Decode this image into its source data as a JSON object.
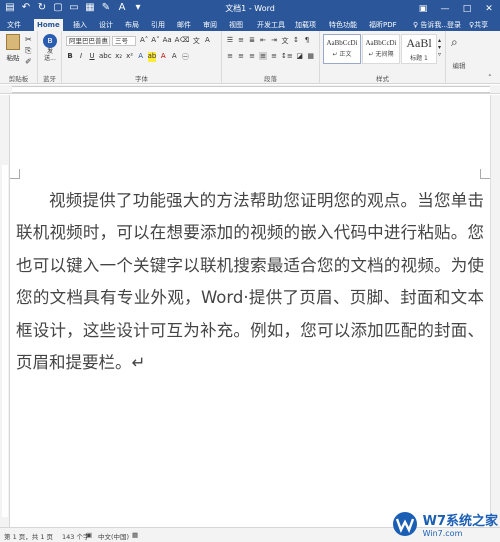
{
  "window": {
    "title": "文档1 - Word"
  },
  "tabs": [
    "文件",
    "Home",
    "插入",
    "设计",
    "布局",
    "引用",
    "邮件",
    "审阅",
    "视图",
    "开发工具",
    "加载项",
    "特色功能",
    "福昕PDF"
  ],
  "tell_me": "♀ 告诉我...",
  "signin": "登录",
  "share": "♀共享",
  "ribbon": {
    "clipboard": {
      "label": "剪贴板",
      "paste": "粘贴"
    },
    "bluetooth": {
      "label": "蓝牙",
      "send": "发\n送..."
    },
    "font": {
      "label": "字体",
      "name": "阿里巴巴普惠",
      "size": "三号"
    },
    "paragraph": {
      "label": "段落"
    },
    "styles": {
      "label": "样式",
      "items": [
        {
          "sample": "AaBbCcDi",
          "name": "↵ 正文"
        },
        {
          "sample": "AaBbCcDi",
          "name": "↵ 无间隔"
        },
        {
          "sample": "AaBl",
          "name": "标题 1"
        }
      ]
    },
    "editing": {
      "label": "编辑"
    }
  },
  "document": {
    "paragraph": "视频提供了功能强大的方法帮助您证明您的观点。当您单击联机视频时，可以在想要添加的视频的嵌入代码中进行粘贴。您也可以键入一个关键字以联机搜索最适合您的文档的视频。为使您的文档具有专业外观，Word·提供了页眉、页脚、封面和文本框设计，这些设计可互为补充。例如，您可以添加匹配的封面、页眉和提要栏。↵"
  },
  "status": {
    "page": "第 1 页，共 1 页",
    "words": "143 个字",
    "language": "中文(中国)"
  },
  "watermark": {
    "brand": "W7系统之家",
    "url": "Win7.com"
  },
  "colors": {
    "ribbon_blue": "#2b579a",
    "ribbon_bg": "#f3f3f3",
    "text": "#444444"
  }
}
